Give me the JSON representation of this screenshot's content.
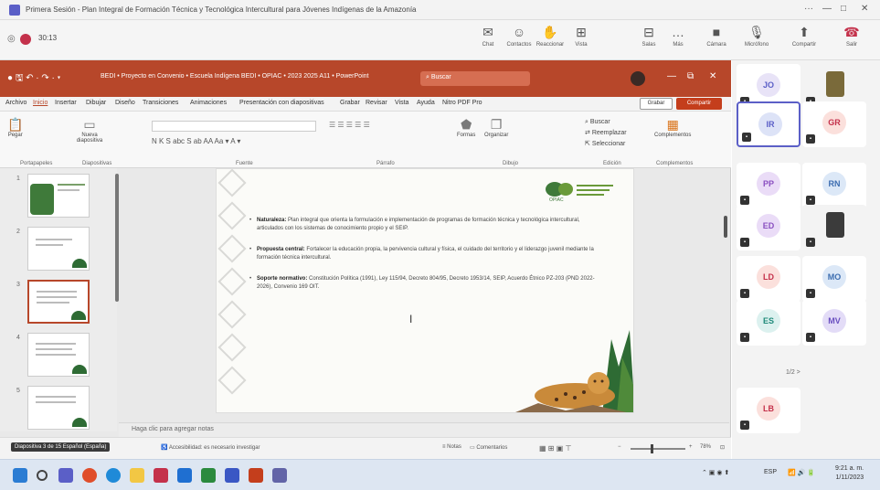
{
  "teams": {
    "window_title": "Primera Sesión - Plan Integral de Formación Técnica y Tecnológica Intercultural para Jóvenes Indígenas de la Amazonía",
    "timer": "30:13",
    "toolbar": [
      {
        "key": "chat",
        "label": "Chat"
      },
      {
        "key": "people",
        "label": "Contactos"
      },
      {
        "key": "react",
        "label": "Reaccionar"
      },
      {
        "key": "view",
        "label": "Vista"
      },
      {
        "key": "rooms",
        "label": "Salas"
      },
      {
        "key": "more",
        "label": "Más"
      },
      {
        "key": "camera",
        "label": "Cámara"
      },
      {
        "key": "mic",
        "label": "Micrófono"
      },
      {
        "key": "share",
        "label": "Compartir"
      },
      {
        "key": "leave",
        "label": "Salir"
      }
    ],
    "pager": "1/2 >"
  },
  "ppt": {
    "title": "BEDI • Proyecto en Convenio • Escuela Indígena BEDI • OPIAC • 2023 2025 A11 • PowerPoint",
    "search_placeholder": "Buscar",
    "menu": [
      "Archivo",
      "Inicio",
      "Insertar",
      "Dibujar",
      "Diseño",
      "Transiciones",
      "Animaciones",
      "Presentación con diapositivas",
      "Grabar",
      "Revisar",
      "Vista",
      "Ayuda",
      "Nitro PDF Pro"
    ],
    "grabar_label": "Grabar",
    "compartir_label": "Compartir",
    "ribbon_groups": [
      "Portapapeles",
      "Diapositivas",
      "Fuente",
      "Párrafo",
      "Dibujo",
      "Edición",
      "Complementos"
    ],
    "ribbon_buttons": {
      "pegar": "Pegar",
      "nueva": "Nueva diapositiva",
      "formas": "Formas",
      "organizar": "Organizar",
      "buscar": "Buscar",
      "reemplazar": "Reemplazar",
      "seleccionar": "Seleccionar",
      "complementos": "Complementos"
    },
    "thumb_numbers": [
      "1",
      "2",
      "3",
      "4",
      "5"
    ],
    "slide": {
      "logo_text": "OPIAC",
      "bullets": [
        {
          "term": "Naturaleza:",
          "text": " Plan integral que orienta la formulación e implementación de programas de formación técnica y tecnológica intercultural, articulados con los sistemas de conocimiento propio y el SEIP."
        },
        {
          "term": "Propuesta central:",
          "text": " Fortalecer la educación propia, la pervivencia cultural y física, el cuidado del territorio y el liderazgo juvenil mediante la formación técnica intercultural."
        },
        {
          "term": "Soporte normativo:",
          "text": " Constitución Política (1991), Ley 115/94, Decreto 804/95, Decreto 1953/14, SEIP, Acuerdo Étnico PZ-203 (PND 2022-2026), Convenio 169 OIT."
        }
      ]
    },
    "notes_placeholder": "Haga clic para agregar notas",
    "status": {
      "tooltip": "Diapositiva 3 de 15 Español (España)",
      "accessibility": "Accesibilidad: es necesario investigar",
      "notes": "Notas",
      "comments": "Comentarios",
      "zoom": "78%"
    }
  },
  "participants": [
    {
      "initials": "JO",
      "color": "#e8e3f7",
      "text": "#5b5fc7"
    },
    {
      "photo": true,
      "color": "#7a6a3a"
    },
    {
      "initials": "IR",
      "color": "#dde3f7",
      "text": "#5b5fc7",
      "selected": true
    },
    {
      "initials": "GR",
      "color": "#fbe0dc",
      "text": "#c4314b"
    },
    {
      "initials": "PP",
      "color": "#eadcf7",
      "text": "#8a4fc0"
    },
    {
      "initials": "RN",
      "color": "#dce8f7",
      "text": "#3c6db0"
    },
    {
      "initials": "ED",
      "color": "#eadcf7",
      "text": "#8a4fc0"
    },
    {
      "photo": true,
      "color": "#3b3b3b"
    },
    {
      "initials": "LD",
      "color": "#fbe0dc",
      "text": "#c4314b"
    },
    {
      "initials": "MO",
      "color": "#dce8f7",
      "text": "#3c6db0"
    },
    {
      "initials": "ES",
      "color": "#dcf1ef",
      "text": "#1f8a7a"
    },
    {
      "initials": "MV",
      "color": "#e3dcf7",
      "text": "#6a4fc0"
    },
    {
      "initials": "LB",
      "color": "#fbe0dc",
      "text": "#c4314b"
    }
  ],
  "taskbar": {
    "time": "9:21 a. m.",
    "date": "1/11/2023",
    "lang": "ESP"
  }
}
